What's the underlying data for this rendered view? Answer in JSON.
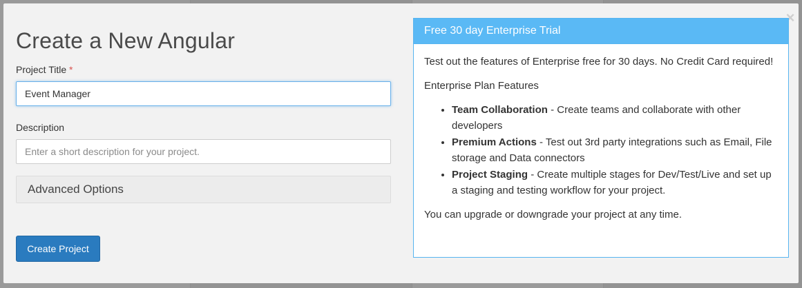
{
  "modal": {
    "title": "Create a New Angular",
    "close_label": "×"
  },
  "form": {
    "project_title_label": "Project Title",
    "required_marker": "*",
    "project_title_value": "Event Manager",
    "description_label": "Description",
    "description_placeholder": "Enter a short description for your project.",
    "advanced_options_label": "Advanced Options",
    "create_button_label": "Create Project"
  },
  "trial_panel": {
    "header": "Free 30 day Enterprise Trial",
    "intro": "Test out the features of Enterprise free for 30 days. No Credit Card required!",
    "features_heading": "Enterprise Plan Features",
    "features": [
      {
        "name": "Team Collaboration",
        "description": " - Create teams and collaborate with other developers"
      },
      {
        "name": "Premium Actions",
        "description": " - Test out 3rd party integrations such as Email, File storage and Data connectors"
      },
      {
        "name": "Project Staging",
        "description": " - Create multiple stages for Dev/Test/Live and set up a staging and testing workflow for your project."
      }
    ],
    "footer": "You can upgrade or downgrade your project at any time."
  },
  "colors": {
    "accent": "#5ab9f5",
    "button": "#2a7bbf",
    "required": "#d9534f"
  }
}
